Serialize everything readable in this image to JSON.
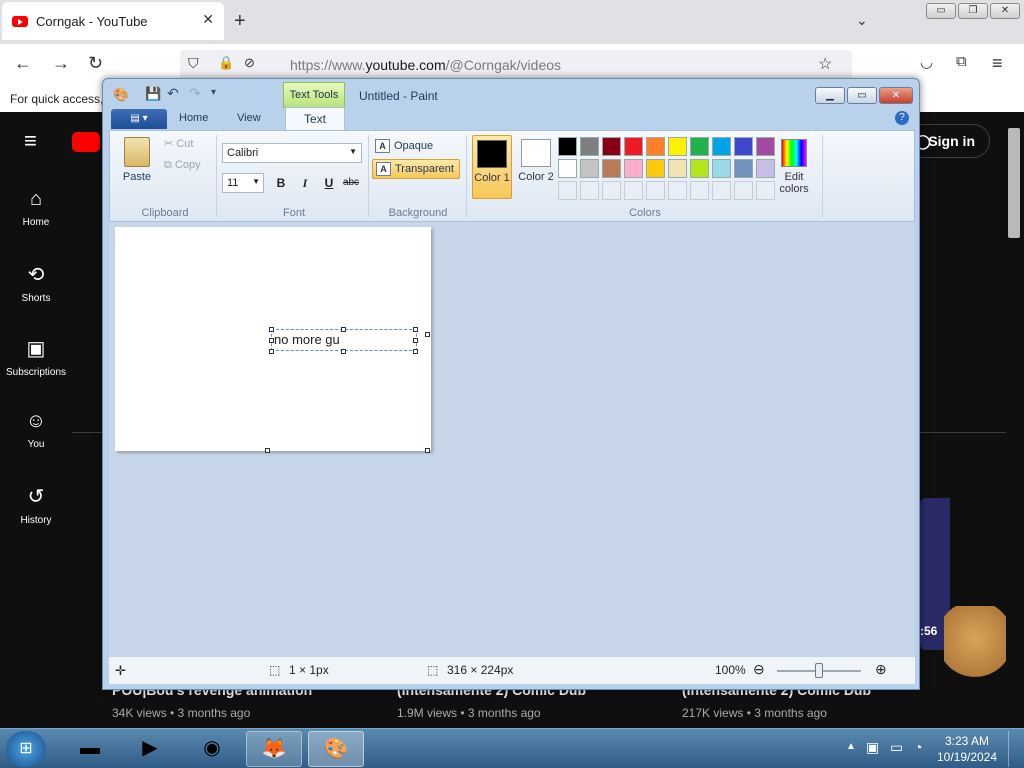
{
  "browser": {
    "tab_title": "Corngak - YouTube",
    "tab_close": "✕",
    "new_tab": "+",
    "tabs_menu": "⌄",
    "win_buttons": [
      "▭",
      "❐",
      "✕"
    ],
    "url_prefix": "https://www.",
    "url_host": "youtube.com",
    "url_path": "/@Corngak/videos",
    "bookmarks_text": "For quick access,"
  },
  "youtube": {
    "sign_in": "Sign in",
    "sidebar": [
      {
        "label": "Home",
        "icon": "home-icon"
      },
      {
        "label": "Shorts",
        "icon": "shorts-icon"
      },
      {
        "label": "Subscriptions",
        "icon": "subscriptions-icon"
      },
      {
        "label": "You",
        "icon": "you-icon"
      },
      {
        "label": "History",
        "icon": "history-icon"
      }
    ],
    "videos": [
      {
        "title": "POU|Bou's revenge animation",
        "meta": "34K views • 3 months ago"
      },
      {
        "title": "(Intensamente 2) Comic Dub",
        "meta": "1.9M views • 3 months ago"
      },
      {
        "title": "(Intensamente 2) Comic Dub",
        "meta": "217K views • 3 months ago"
      }
    ],
    "duration_fragment": ":56"
  },
  "paint": {
    "context_tab": "Text Tools",
    "window_title": "Untitled - Paint",
    "tabs": [
      "Home",
      "View",
      "Text"
    ],
    "clipboard": {
      "paste": "Paste",
      "cut": "Cut",
      "copy": "Copy",
      "group": "Clipboard"
    },
    "font": {
      "family": "Calibri",
      "size": "11",
      "bold": "B",
      "italic": "I",
      "underline": "U",
      "strike": "abc",
      "group": "Font"
    },
    "background": {
      "opaque": "Opaque",
      "transparent": "Transparent",
      "group": "Background"
    },
    "colors": {
      "color1": "Color 1",
      "color2": "Color 2",
      "edit": "Edit colors",
      "group": "Colors",
      "color1_value": "#000000",
      "color2_value": "#ffffff",
      "palette_row1": [
        "#000000",
        "#7f7f7f",
        "#880015",
        "#ed1c24",
        "#ff7f27",
        "#fff200",
        "#22b14c",
        "#00a2e8",
        "#3f48cc",
        "#a349a4"
      ],
      "palette_row2": [
        "#ffffff",
        "#c3c3c3",
        "#b97a57",
        "#ffaec9",
        "#ffc90e",
        "#efe4b0",
        "#b5e61d",
        "#99d9ea",
        "#7092be",
        "#c8bfe7"
      ]
    },
    "canvas_text": "no more gu",
    "status": {
      "selection": "1 × 1px",
      "size": "316 × 224px",
      "zoom": "100%"
    }
  },
  "taskbar": {
    "time": "3:23 AM",
    "date": "10/19/2024"
  }
}
